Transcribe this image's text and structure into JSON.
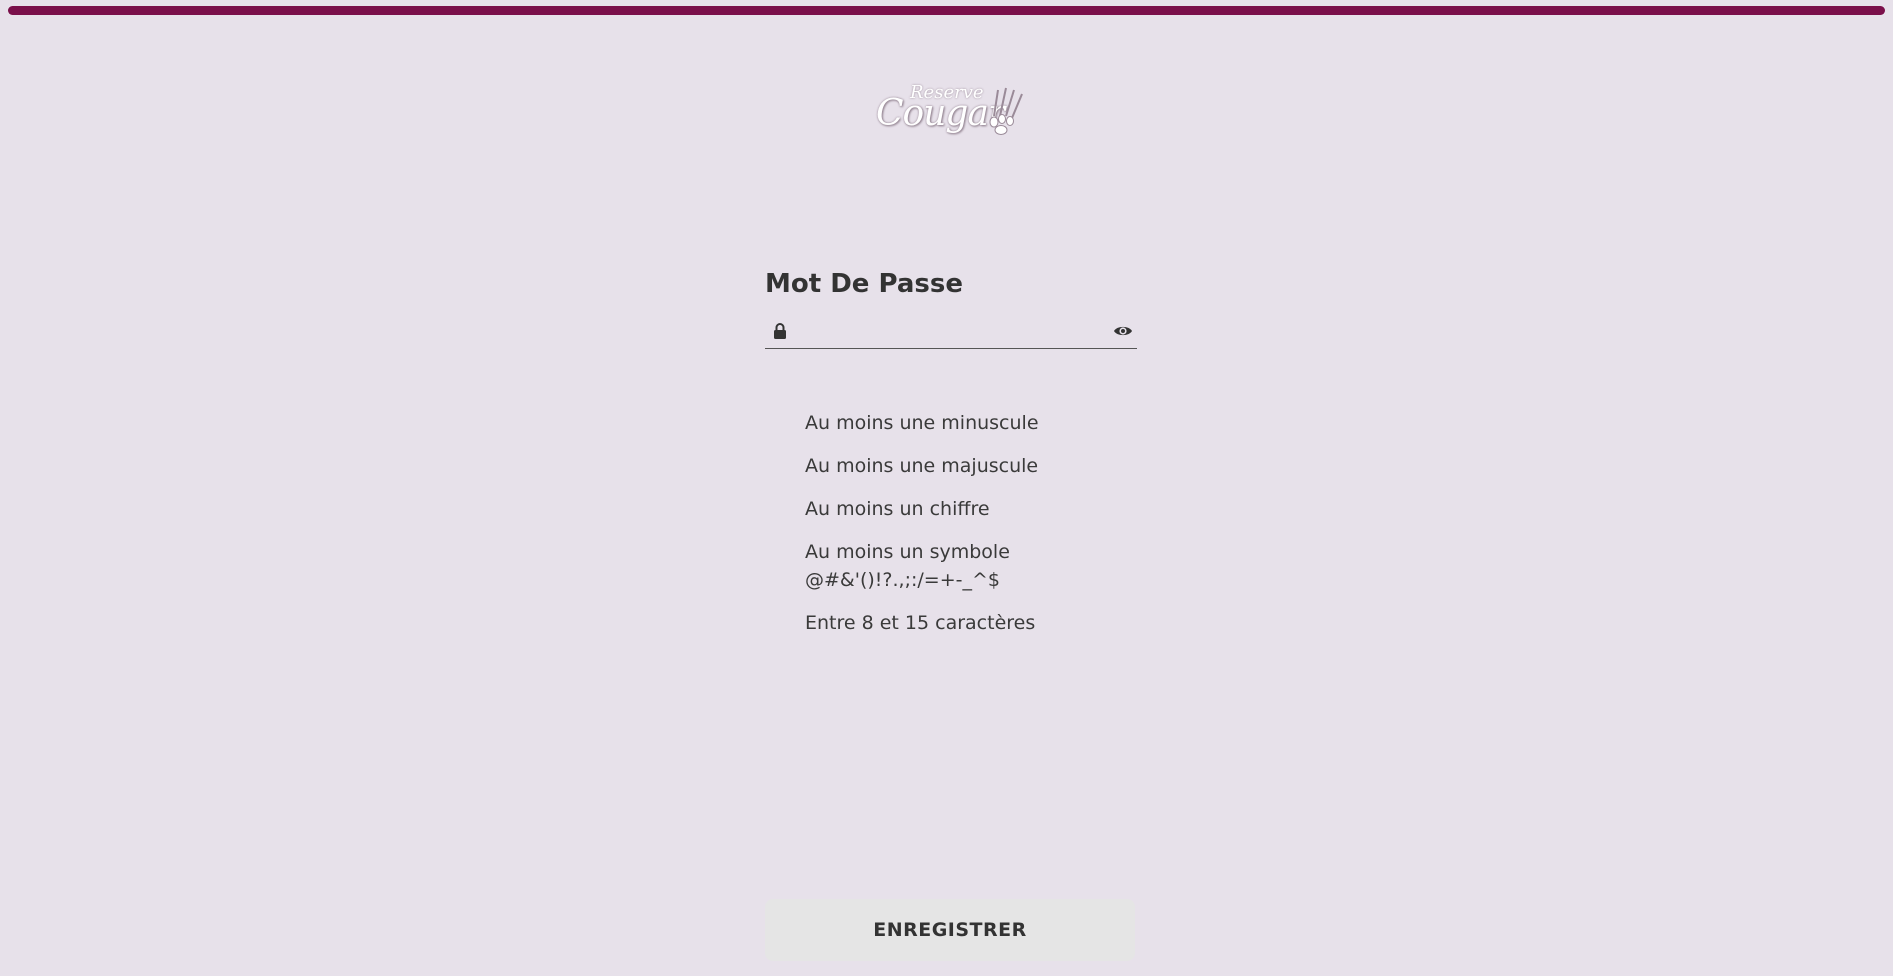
{
  "brand": {
    "logo_text": "Cougar",
    "logo_sub": "Reserve"
  },
  "form": {
    "title": "Mot De Passe",
    "password_value": "",
    "password_placeholder": ""
  },
  "rules": [
    "Au moins une minuscule",
    "Au moins une majuscule",
    "Au moins un chiffre",
    "Au moins un symbole @#&'()!?.,;:/=+-_^$",
    "Entre 8 et 15 caractères"
  ],
  "actions": {
    "save_label": "ENREGISTRER"
  },
  "icons": {
    "lock": "lock-icon",
    "eye": "eye-icon"
  },
  "colors": {
    "background": "#e7e1ea",
    "accent": "#7a0f4a",
    "text": "#333333",
    "button_bg": "#e5e5e5"
  }
}
